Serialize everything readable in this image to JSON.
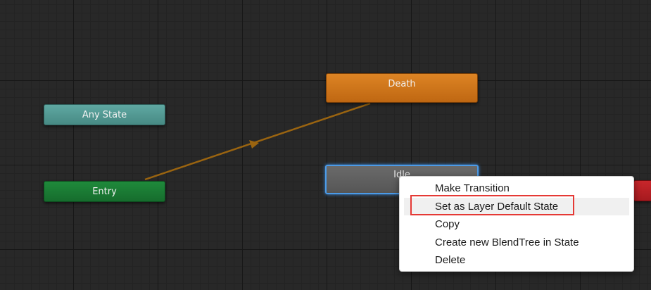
{
  "graph": {
    "nodes": {
      "any_state": "Any State",
      "entry": "Entry",
      "death": "Death",
      "idle": "Idle"
    },
    "colors": {
      "background": "#282828",
      "any_state": "#4f9a94",
      "entry": "#1a7a33",
      "death": "#d27518",
      "idle": "#5f5f5f",
      "idle_selected_outline": "#4b9be8",
      "exit": "#b8201f",
      "transition": "#9a6410"
    }
  },
  "context_menu": {
    "items": [
      {
        "label": "Make Transition"
      },
      {
        "label": "Set as Layer Default State"
      },
      {
        "label": "Copy"
      },
      {
        "label": "Create new BlendTree in State"
      },
      {
        "label": "Delete"
      }
    ],
    "hovered_item": "Set as Layer Default State",
    "annotation_color": "#e53935"
  }
}
